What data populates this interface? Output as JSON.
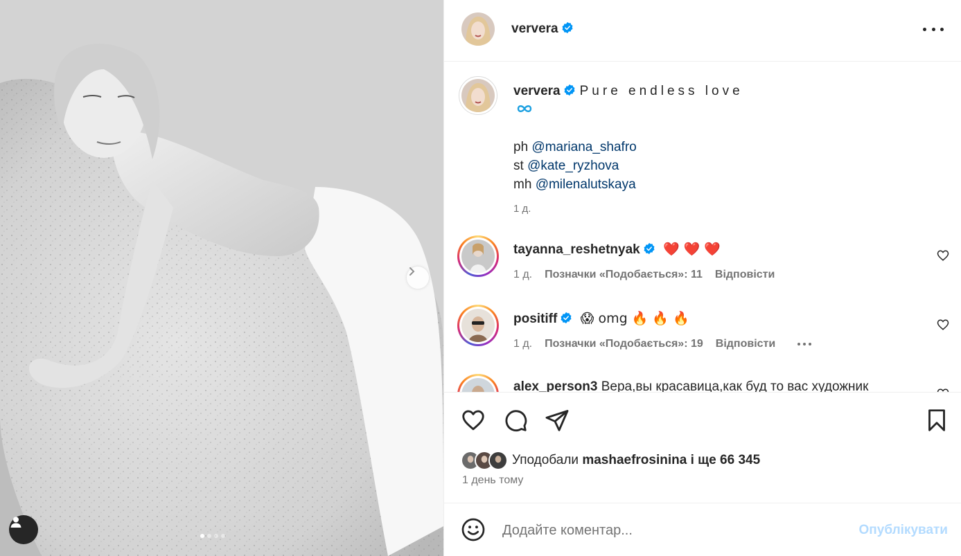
{
  "post": {
    "author": "ververa",
    "verified": true
  },
  "caption": {
    "username": "ververa",
    "title": "Pure endless love",
    "symbol": "∞",
    "credits": [
      {
        "role": "ph",
        "handle": "@mariana_shafro"
      },
      {
        "role": "st",
        "handle": "@kate_ryzhova"
      },
      {
        "role": "mh",
        "handle": "@milenalutskaya"
      }
    ],
    "time": "1 д."
  },
  "comments": [
    {
      "username": "tayanna_reshetnyak",
      "text": "❤️ ❤️ ❤️",
      "time": "1 д.",
      "likes": "Позначки «Подобається»: 11",
      "reply": "Відповісти"
    },
    {
      "username": "positiff",
      "text": "😱 omg 🔥 🔥 🔥",
      "time": "1 д.",
      "likes": "Позначки «Подобається»: 19",
      "reply": "Відповісти"
    },
    {
      "username": "alex_person3",
      "text": "Вера,вы красавица,как буд то вас художник"
    }
  ],
  "likes": {
    "prefix": "Уподобали",
    "user": "mashaefrosinina",
    "suffix": "і ще 66 345"
  },
  "post_time": "1 день тому",
  "add_comment": {
    "placeholder": "Додайте коментар...",
    "publish": "Опублікувати"
  },
  "carousel": {
    "total": 4,
    "active": 0
  },
  "colors": {
    "link": "#00376b",
    "verified": "#0095f6",
    "publish_disabled": "#b3dbff",
    "muted": "#737373"
  }
}
